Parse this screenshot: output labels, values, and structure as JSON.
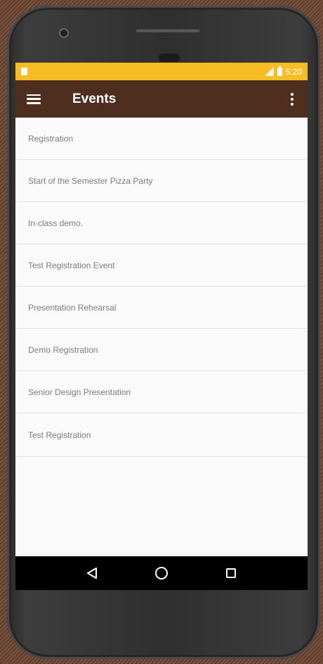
{
  "status_bar": {
    "time": "5:20",
    "background_color": "#f7bd22",
    "notification_icon": "notification-icon",
    "signal_icon": "signal-icon",
    "battery_icon": "battery-icon"
  },
  "app_bar": {
    "title": "Events",
    "background_color": "#4e2e1f",
    "menu_icon": "hamburger-menu-icon",
    "overflow_icon": "more-vert-icon"
  },
  "events": [
    {
      "label": "Registration"
    },
    {
      "label": "Start of the Semester Pizza Party"
    },
    {
      "label": "In-class demo."
    },
    {
      "label": "Test Registration Event"
    },
    {
      "label": "Presentation Rehearsal"
    },
    {
      "label": "Demo Registration"
    },
    {
      "label": "Senior Design Presentation"
    },
    {
      "label": "Test Registration"
    }
  ],
  "nav_bar": {
    "back_icon": "back-triangle-icon",
    "home_icon": "home-circle-icon",
    "recents_icon": "recents-square-icon"
  }
}
